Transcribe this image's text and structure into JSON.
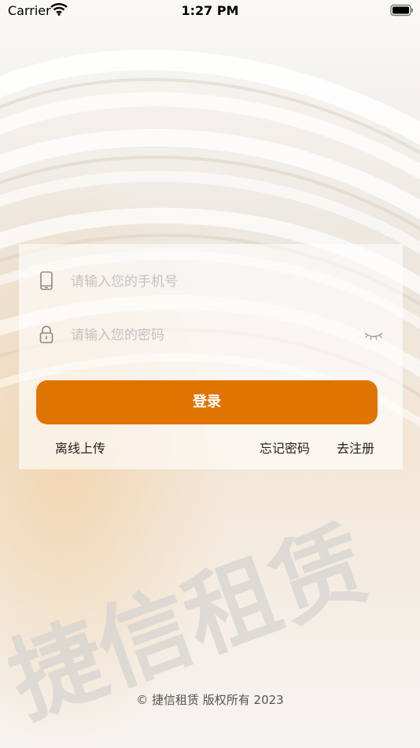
{
  "status_bar": {
    "carrier": "Carrier",
    "time": "1:27 PM"
  },
  "login": {
    "phone_placeholder": "请输入您的手机号",
    "password_placeholder": "请输入您的密码",
    "phone_value": "",
    "password_value": "",
    "submit_label": "登录",
    "offline_upload_label": "离线上传",
    "forgot_password_label": "忘记密码",
    "register_label": "去注册"
  },
  "watermark": {
    "text": "捷信租赁"
  },
  "footer": {
    "copyright": "© 捷信租赁  版权所有 2023"
  },
  "colors": {
    "accent": "#e07400",
    "background": "#f4f1ed"
  },
  "icons": {
    "phone": "mobile-phone-icon",
    "lock": "lock-icon",
    "eye": "eye-closed-icon",
    "wifi": "wifi-icon",
    "battery": "battery-icon"
  }
}
